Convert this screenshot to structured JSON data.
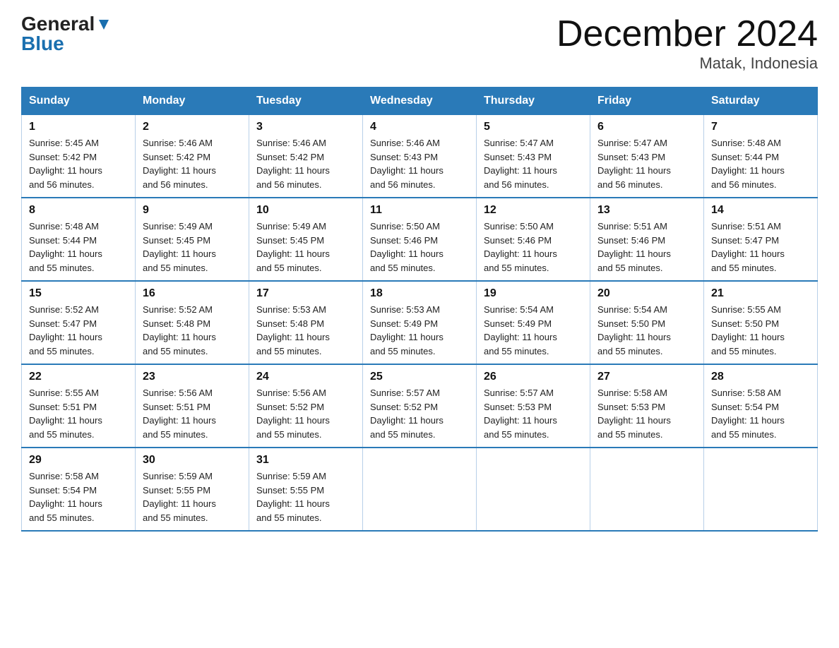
{
  "logo": {
    "general": "General",
    "blue": "Blue",
    "arrow": "▼"
  },
  "title": "December 2024",
  "location": "Matak, Indonesia",
  "days_of_week": [
    "Sunday",
    "Monday",
    "Tuesday",
    "Wednesday",
    "Thursday",
    "Friday",
    "Saturday"
  ],
  "weeks": [
    [
      {
        "day": "1",
        "sunrise": "5:45 AM",
        "sunset": "5:42 PM",
        "daylight": "11 hours and 56 minutes."
      },
      {
        "day": "2",
        "sunrise": "5:46 AM",
        "sunset": "5:42 PM",
        "daylight": "11 hours and 56 minutes."
      },
      {
        "day": "3",
        "sunrise": "5:46 AM",
        "sunset": "5:42 PM",
        "daylight": "11 hours and 56 minutes."
      },
      {
        "day": "4",
        "sunrise": "5:46 AM",
        "sunset": "5:43 PM",
        "daylight": "11 hours and 56 minutes."
      },
      {
        "day": "5",
        "sunrise": "5:47 AM",
        "sunset": "5:43 PM",
        "daylight": "11 hours and 56 minutes."
      },
      {
        "day": "6",
        "sunrise": "5:47 AM",
        "sunset": "5:43 PM",
        "daylight": "11 hours and 56 minutes."
      },
      {
        "day": "7",
        "sunrise": "5:48 AM",
        "sunset": "5:44 PM",
        "daylight": "11 hours and 56 minutes."
      }
    ],
    [
      {
        "day": "8",
        "sunrise": "5:48 AM",
        "sunset": "5:44 PM",
        "daylight": "11 hours and 55 minutes."
      },
      {
        "day": "9",
        "sunrise": "5:49 AM",
        "sunset": "5:45 PM",
        "daylight": "11 hours and 55 minutes."
      },
      {
        "day": "10",
        "sunrise": "5:49 AM",
        "sunset": "5:45 PM",
        "daylight": "11 hours and 55 minutes."
      },
      {
        "day": "11",
        "sunrise": "5:50 AM",
        "sunset": "5:46 PM",
        "daylight": "11 hours and 55 minutes."
      },
      {
        "day": "12",
        "sunrise": "5:50 AM",
        "sunset": "5:46 PM",
        "daylight": "11 hours and 55 minutes."
      },
      {
        "day": "13",
        "sunrise": "5:51 AM",
        "sunset": "5:46 PM",
        "daylight": "11 hours and 55 minutes."
      },
      {
        "day": "14",
        "sunrise": "5:51 AM",
        "sunset": "5:47 PM",
        "daylight": "11 hours and 55 minutes."
      }
    ],
    [
      {
        "day": "15",
        "sunrise": "5:52 AM",
        "sunset": "5:47 PM",
        "daylight": "11 hours and 55 minutes."
      },
      {
        "day": "16",
        "sunrise": "5:52 AM",
        "sunset": "5:48 PM",
        "daylight": "11 hours and 55 minutes."
      },
      {
        "day": "17",
        "sunrise": "5:53 AM",
        "sunset": "5:48 PM",
        "daylight": "11 hours and 55 minutes."
      },
      {
        "day": "18",
        "sunrise": "5:53 AM",
        "sunset": "5:49 PM",
        "daylight": "11 hours and 55 minutes."
      },
      {
        "day": "19",
        "sunrise": "5:54 AM",
        "sunset": "5:49 PM",
        "daylight": "11 hours and 55 minutes."
      },
      {
        "day": "20",
        "sunrise": "5:54 AM",
        "sunset": "5:50 PM",
        "daylight": "11 hours and 55 minutes."
      },
      {
        "day": "21",
        "sunrise": "5:55 AM",
        "sunset": "5:50 PM",
        "daylight": "11 hours and 55 minutes."
      }
    ],
    [
      {
        "day": "22",
        "sunrise": "5:55 AM",
        "sunset": "5:51 PM",
        "daylight": "11 hours and 55 minutes."
      },
      {
        "day": "23",
        "sunrise": "5:56 AM",
        "sunset": "5:51 PM",
        "daylight": "11 hours and 55 minutes."
      },
      {
        "day": "24",
        "sunrise": "5:56 AM",
        "sunset": "5:52 PM",
        "daylight": "11 hours and 55 minutes."
      },
      {
        "day": "25",
        "sunrise": "5:57 AM",
        "sunset": "5:52 PM",
        "daylight": "11 hours and 55 minutes."
      },
      {
        "day": "26",
        "sunrise": "5:57 AM",
        "sunset": "5:53 PM",
        "daylight": "11 hours and 55 minutes."
      },
      {
        "day": "27",
        "sunrise": "5:58 AM",
        "sunset": "5:53 PM",
        "daylight": "11 hours and 55 minutes."
      },
      {
        "day": "28",
        "sunrise": "5:58 AM",
        "sunset": "5:54 PM",
        "daylight": "11 hours and 55 minutes."
      }
    ],
    [
      {
        "day": "29",
        "sunrise": "5:58 AM",
        "sunset": "5:54 PM",
        "daylight": "11 hours and 55 minutes."
      },
      {
        "day": "30",
        "sunrise": "5:59 AM",
        "sunset": "5:55 PM",
        "daylight": "11 hours and 55 minutes."
      },
      {
        "day": "31",
        "sunrise": "5:59 AM",
        "sunset": "5:55 PM",
        "daylight": "11 hours and 55 minutes."
      },
      null,
      null,
      null,
      null
    ]
  ],
  "labels": {
    "sunrise": "Sunrise:",
    "sunset": "Sunset:",
    "daylight": "Daylight:"
  }
}
